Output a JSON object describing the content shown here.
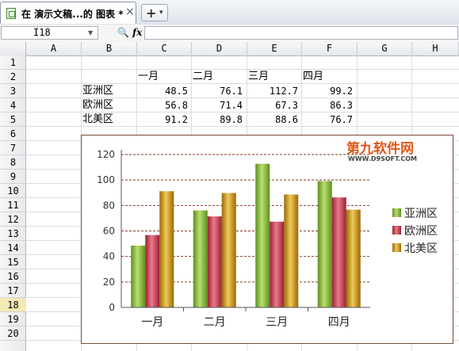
{
  "tab": {
    "title": "在 演示文稿...的 图表 *",
    "close": "×",
    "new": "+",
    "dropdown": "▾"
  },
  "formula_bar": {
    "cell_ref": "I18",
    "zoom": "🔍",
    "fx": "fx",
    "formula": ""
  },
  "columns": [
    "A",
    "B",
    "C",
    "D",
    "E",
    "F",
    "G",
    "H"
  ],
  "rows": [
    "1",
    "2",
    "3",
    "4",
    "5",
    "6",
    "7",
    "8",
    "9",
    "10",
    "11",
    "12",
    "13",
    "14",
    "15",
    "16",
    "17",
    "18",
    "19",
    "20"
  ],
  "active_row": "18",
  "table": {
    "headers": [
      "一月",
      "二月",
      "三月",
      "四月"
    ],
    "rows": [
      {
        "label": "亚洲区",
        "values": [
          "48.5",
          "76.1",
          "112.7",
          "99.2"
        ]
      },
      {
        "label": "欧洲区",
        "values": [
          "56.8",
          "71.4",
          "67.3",
          "86.3"
        ]
      },
      {
        "label": "北美区",
        "values": [
          "91.2",
          "89.8",
          "88.6",
          "76.7"
        ]
      }
    ]
  },
  "watermark": {
    "text": "第九软件网",
    "url": "WWW.D9SOFT.COM"
  },
  "colors": {
    "亚洲区": "#7bb32e",
    "欧洲区": "#c2344a",
    "北美区": "#c8940c",
    "grid": "#8b3a2a"
  },
  "chart_data": {
    "type": "bar",
    "categories": [
      "一月",
      "二月",
      "三月",
      "四月"
    ],
    "series": [
      {
        "name": "亚洲区",
        "values": [
          48.5,
          76.1,
          112.7,
          99.2
        ]
      },
      {
        "name": "欧洲区",
        "values": [
          56.8,
          71.4,
          67.3,
          86.3
        ]
      },
      {
        "name": "北美区",
        "values": [
          91.2,
          89.8,
          88.6,
          76.7
        ]
      }
    ],
    "yticks": [
      "0",
      "20",
      "40",
      "60",
      "80",
      "100",
      "120"
    ],
    "ylim": [
      0,
      120
    ],
    "legend_position": "right",
    "grid": true
  }
}
